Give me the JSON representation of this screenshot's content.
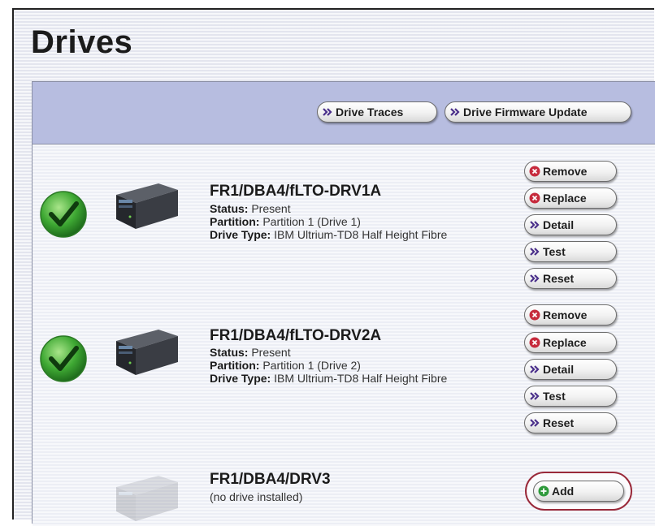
{
  "page": {
    "title": "Drives"
  },
  "toolbar": {
    "drive_traces_label": "Drive Traces",
    "firmware_update_label": "Drive Firmware Update"
  },
  "drives": [
    {
      "name": "FR1/DBA4/fLTO-DRV1A",
      "status_label": "Status:",
      "status": "Present",
      "partition_label": "Partition:",
      "partition": "Partition 1 (Drive 1)",
      "type_label": "Drive Type:",
      "type": "IBM Ultrium-TD8 Half Height Fibre",
      "state": "ok",
      "actions": [
        "Remove",
        "Replace",
        "Detail",
        "Test",
        "Reset"
      ]
    },
    {
      "name": "FR1/DBA4/fLTO-DRV2A",
      "status_label": "Status:",
      "status": "Present",
      "partition_label": "Partition:",
      "partition": "Partition 1 (Drive 2)",
      "type_label": "Drive Type:",
      "type": "IBM Ultrium-TD8 Half Height Fibre",
      "state": "ok",
      "actions": [
        "Remove",
        "Replace",
        "Detail",
        "Test",
        "Reset"
      ]
    },
    {
      "name": "FR1/DBA4/DRV3",
      "note": "(no drive installed)",
      "state": "empty",
      "actions": [
        "Add"
      ]
    }
  ],
  "colors": {
    "header_bg": "#b7bde0",
    "arrow_icon": "#4a2f8a",
    "remove_icon": "#c62a3c",
    "add_icon": "#2f9a3c",
    "highlight_ring": "#9a2a3a",
    "check_green": "#3ea833"
  },
  "icons": {
    "action_arrow": "double-chevron-right-icon",
    "remove": "remove-circle-icon",
    "add": "add-circle-icon",
    "status": "checkmark-icon",
    "drive": "tape-drive-icon"
  }
}
